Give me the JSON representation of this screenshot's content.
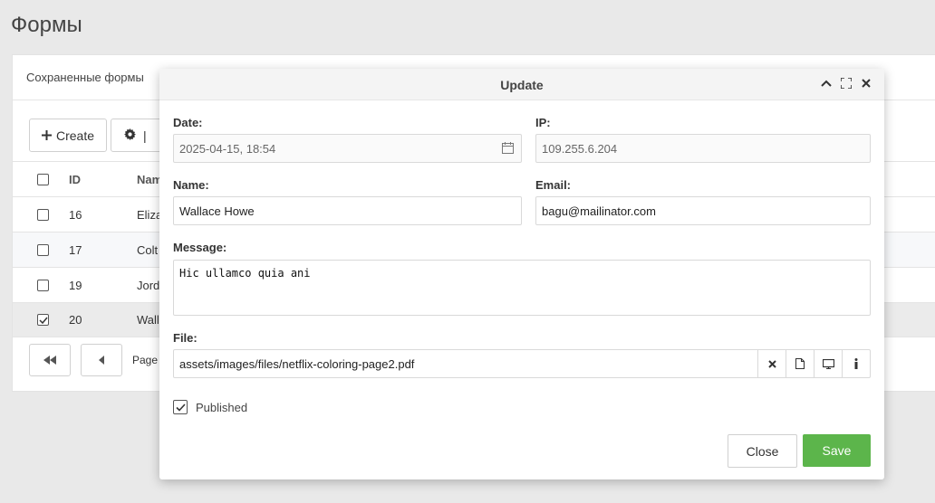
{
  "page": {
    "title": "Формы"
  },
  "panel": {
    "header": "Сохраненные формы"
  },
  "toolbar": {
    "create_label": "Create"
  },
  "grid": {
    "columns": [
      "ID",
      "Nam"
    ],
    "rows": [
      {
        "id": "16",
        "name": "Eliza",
        "checked": false
      },
      {
        "id": "17",
        "name": "Colt",
        "checked": false
      },
      {
        "id": "19",
        "name": "Jorda",
        "checked": false
      },
      {
        "id": "20",
        "name": "Walla",
        "checked": true
      }
    ]
  },
  "pager": {
    "page_label": "Page"
  },
  "modal": {
    "title": "Update",
    "date": {
      "label": "Date:",
      "value": "2025-04-15, 18:54"
    },
    "ip": {
      "label": "IP:",
      "value": "109.255.6.204"
    },
    "name": {
      "label": "Name:",
      "value": "Wallace Howe"
    },
    "email": {
      "label": "Email:",
      "value": "bagu@mailinator.com"
    },
    "message": {
      "label": "Message:",
      "value": "Hic ullamco quia ani"
    },
    "file": {
      "label": "File:",
      "value": "assets/images/files/netflix-coloring-page2.pdf"
    },
    "published": {
      "label": "Published",
      "checked": true
    },
    "close_label": "Close",
    "save_label": "Save"
  },
  "colors": {
    "save": "#5cb54b",
    "selected_row": "#ebebeb"
  }
}
